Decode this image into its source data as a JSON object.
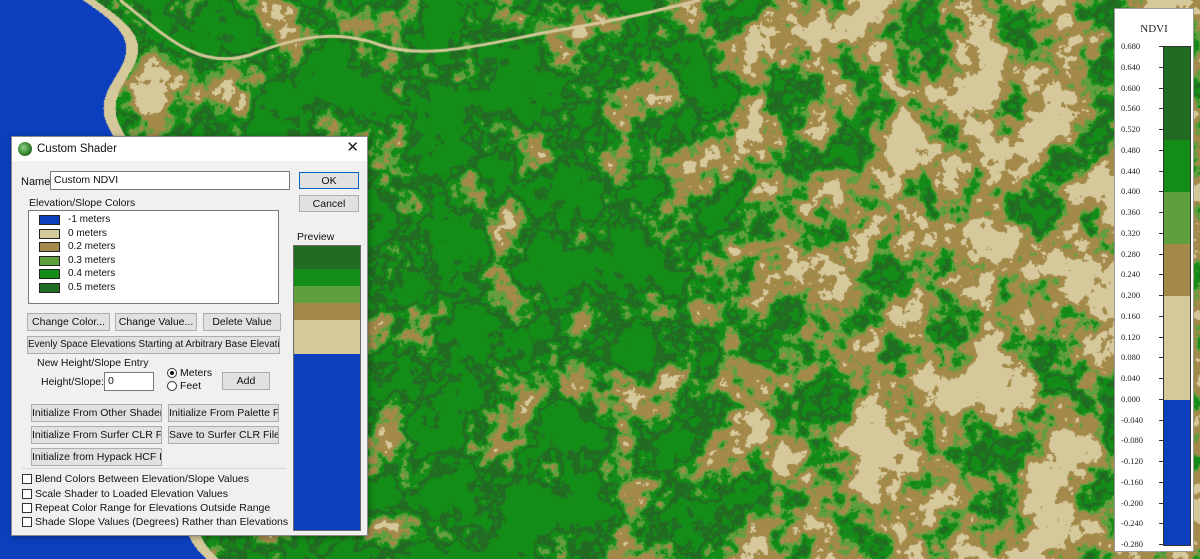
{
  "map": {
    "colors": {
      "water": "#0c3fbe",
      "dark_green": "#226b23",
      "green": "#148c18",
      "light_green": "#5f9f3d",
      "tan": "#a48a4a",
      "beige": "#d5c89a"
    }
  },
  "legend": {
    "title": "NDVI",
    "ticks": [
      "0.680",
      "0.640",
      "0.600",
      "0.560",
      "0.520",
      "0.480",
      "0.440",
      "0.400",
      "0.360",
      "0.320",
      "0.280",
      "0.240",
      "0.200",
      "0.160",
      "0.120",
      "0.080",
      "0.040",
      "0.000",
      "-0.040",
      "-0.080",
      "-0.120",
      "-0.160",
      "-0.200",
      "-0.240",
      "-0.280"
    ],
    "segments": [
      {
        "from": 0.5,
        "to": 0.68,
        "color": "#226b23"
      },
      {
        "from": 0.4,
        "to": 0.5,
        "color": "#148c18"
      },
      {
        "from": 0.3,
        "to": 0.4,
        "color": "#5f9f3d"
      },
      {
        "from": 0.2,
        "to": 0.3,
        "color": "#a48a4a"
      },
      {
        "from": 0.0,
        "to": 0.2,
        "color": "#d5c89a"
      },
      {
        "from": -0.28,
        "to": 0.0,
        "color": "#0c3fbe"
      }
    ]
  },
  "dialog": {
    "title": "Custom Shader",
    "close_icon": "close-icon",
    "name_label": "Name",
    "name_value": "Custom NDVI",
    "ok_label": "OK",
    "cancel_label": "Cancel",
    "colors_label": "Elevation/Slope Colors",
    "color_entries": [
      {
        "label": "-1 meters",
        "color": "#0c3fbe"
      },
      {
        "label": "0 meters",
        "color": "#d5c89a"
      },
      {
        "label": "0.2 meters",
        "color": "#a48a4a"
      },
      {
        "label": "0.3 meters",
        "color": "#5f9f3d"
      },
      {
        "label": "0.4 meters",
        "color": "#148c18"
      },
      {
        "label": "0.5 meters",
        "color": "#226b23"
      }
    ],
    "change_color_label": "Change Color...",
    "change_value_label": "Change Value...",
    "delete_value_label": "Delete Value",
    "evenly_space_label": "Evenly Space Elevations Starting at Arbitrary Base Elevation...",
    "new_entry_label": "New Height/Slope Entry",
    "height_slope_label": "Height/Slope:",
    "height_slope_value": "0",
    "meters_label": "Meters",
    "feet_label": "Feet",
    "add_label": "Add",
    "init_other_shader_label": "Initialize From Other Shader",
    "init_palette_label": "Initialize From Palette File...",
    "init_surfer_label": "Initialize From Surfer CLR File...",
    "save_surfer_label": "Save to Surfer CLR File...",
    "init_hypack_label": "Initialize from Hypack HCF File...",
    "blend_label": "Blend Colors Between Elevation/Slope Values",
    "scale_label": "Scale Shader to Loaded Elevation Values",
    "repeat_label": "Repeat Color Range for Elevations Outside Range",
    "shade_slope_label": "Shade Slope Values (Degrees) Rather than Elevations",
    "preview_label": "Preview",
    "preview_colors": [
      "#226b23",
      "#148c18",
      "#5f9f3d",
      "#a48a4a",
      "#d5c89a",
      "#0c3fbe"
    ],
    "preview_fraction": [
      0.08,
      0.06,
      0.06,
      0.06,
      0.12,
      0.62
    ]
  }
}
